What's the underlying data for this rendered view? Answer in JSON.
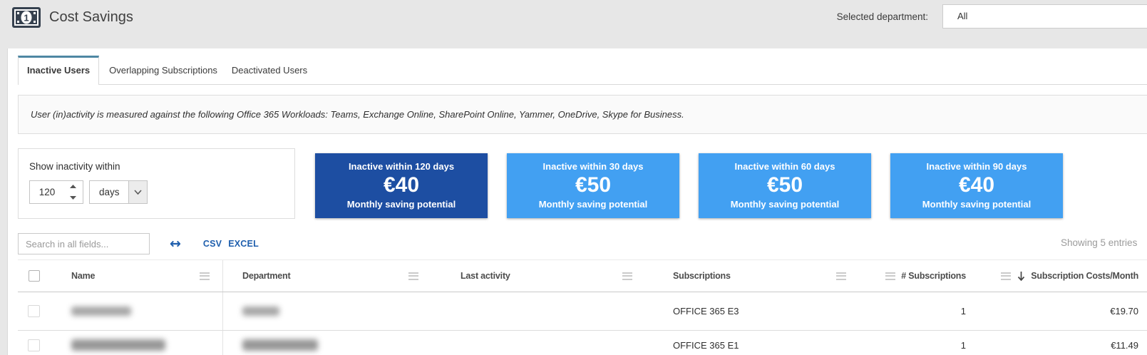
{
  "colors": {
    "tab_accent": "#4e87a3",
    "card_dark_blue": "#1d4ea2",
    "card_light_blue": "#42a0f2",
    "link_blue": "#1f5fad"
  },
  "header": {
    "title": "Cost Savings",
    "department_label": "Selected department:",
    "department_value": "All"
  },
  "tabs": [
    {
      "label": "Inactive Users",
      "active": true
    },
    {
      "label": "Overlapping Subscriptions",
      "active": false
    },
    {
      "label": "Deactivated Users",
      "active": false
    }
  ],
  "banner": {
    "text": "User (in)activity is measured against the following Office 365 Workloads: Teams, Exchange Online, SharePoint Online, Yammer, OneDrive, Skype for Business."
  },
  "filter": {
    "label": "Show inactivity within",
    "value": "120",
    "unit": "days"
  },
  "cards": [
    {
      "title": "Inactive within 120 days",
      "value": "€40",
      "caption": "Monthly saving potential",
      "variant": "dark"
    },
    {
      "title": "Inactive within 30 days",
      "value": "€50",
      "caption": "Monthly saving potential",
      "variant": "light"
    },
    {
      "title": "Inactive within 60 days",
      "value": "€50",
      "caption": "Monthly saving potential",
      "variant": "light"
    },
    {
      "title": "Inactive within 90 days",
      "value": "€40",
      "caption": "Monthly saving potential",
      "variant": "light"
    }
  ],
  "toolbar": {
    "search_placeholder": "Search in all fields...",
    "export_csv": "CSV",
    "export_excel": "EXCEL",
    "showing_text": "Showing 5 entries"
  },
  "table": {
    "columns": [
      "Name",
      "Department",
      "Last activity",
      "Subscriptions",
      "# Subscriptions",
      "Subscription Costs/Month"
    ],
    "sorted_column": "Subscription Costs/Month",
    "sort_direction": "descending",
    "rows": [
      {
        "name_redacted": true,
        "department_redacted": true,
        "subscriptions": "OFFICE 365 E3",
        "num_subscriptions": "1",
        "cost_month": "€19.70"
      },
      {
        "name_redacted": true,
        "department_redacted": true,
        "subscriptions": "OFFICE 365 E1",
        "num_subscriptions": "1",
        "cost_month": "€11.49"
      }
    ]
  }
}
